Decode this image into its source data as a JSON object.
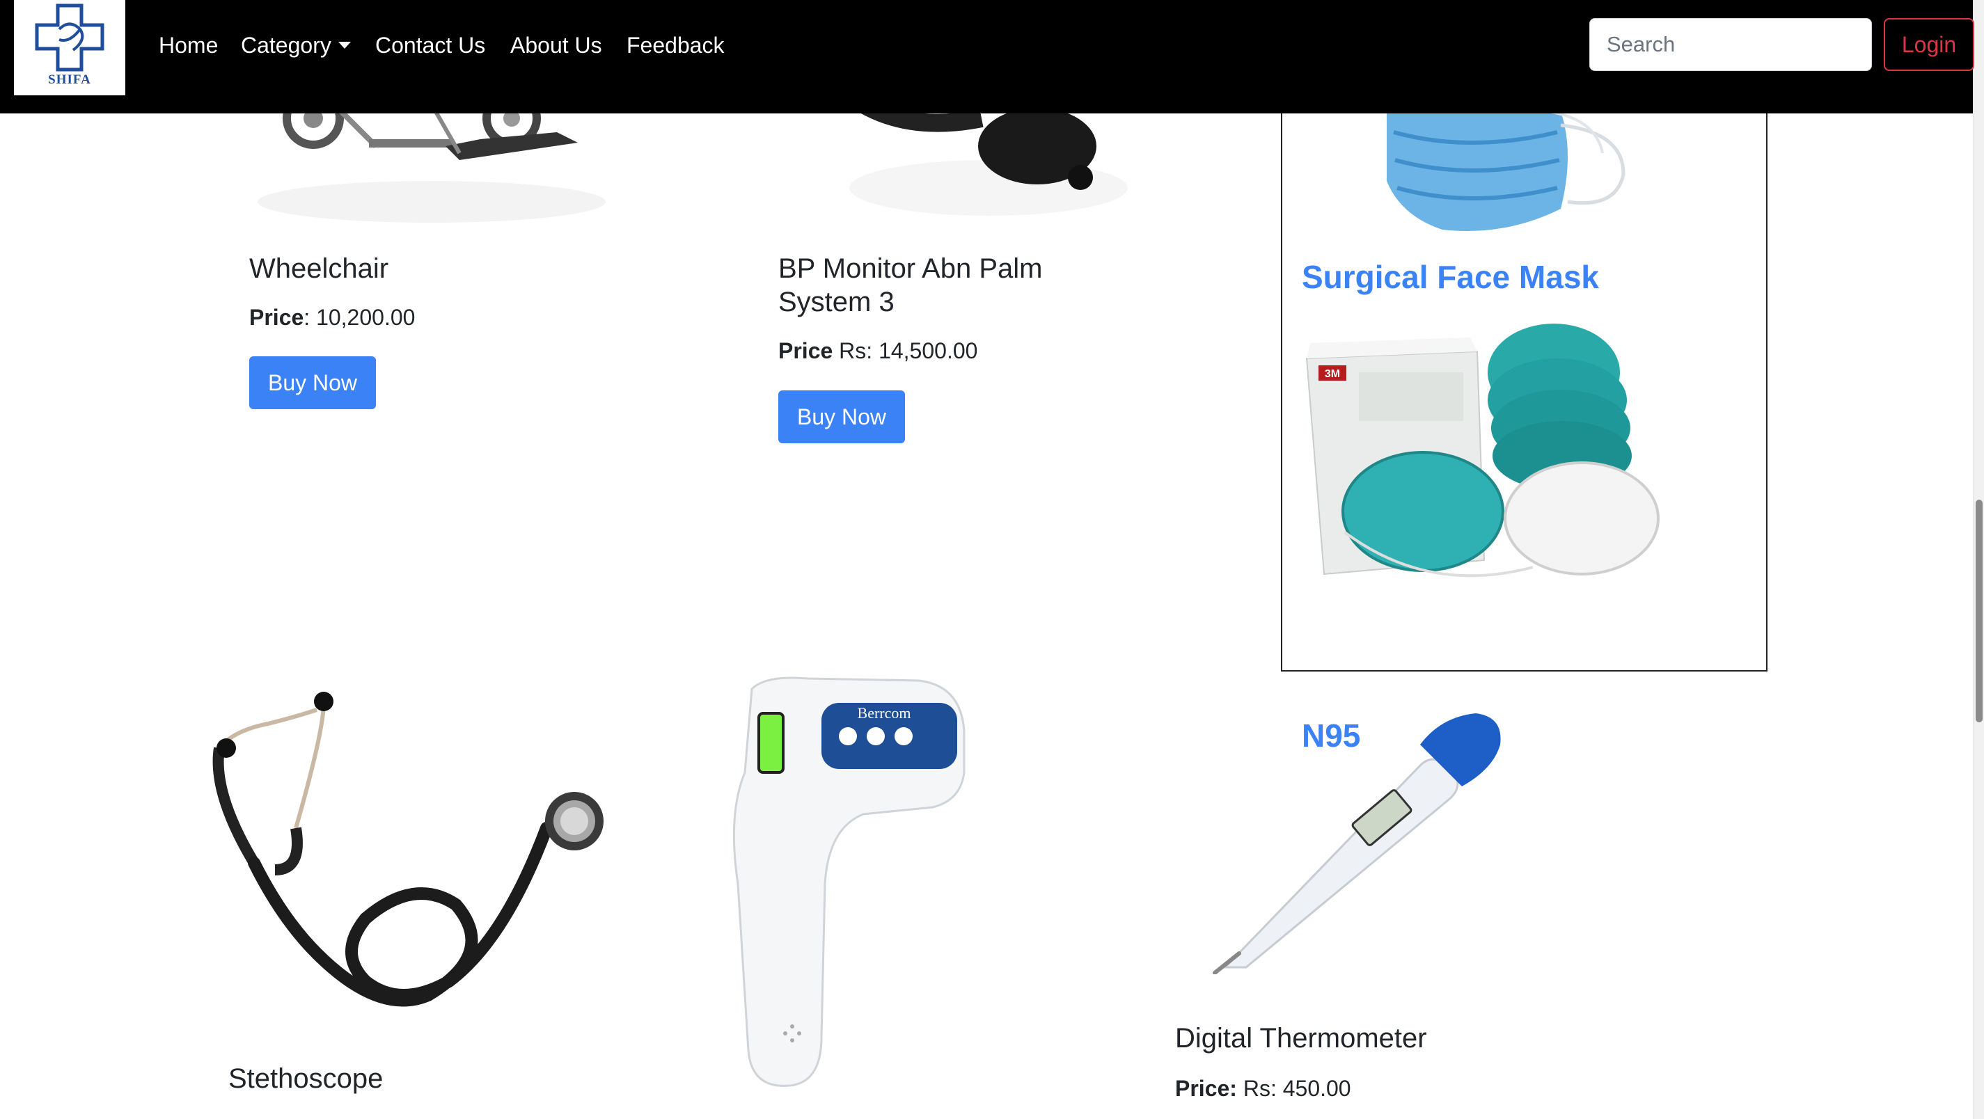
{
  "brand": {
    "name": "SHIFA"
  },
  "nav": {
    "home": "Home",
    "category": "Category",
    "contact": "Contact Us",
    "about": "About Us",
    "feedback": "Feedback"
  },
  "search": {
    "placeholder": "Search"
  },
  "login": {
    "label": "Login"
  },
  "products": [
    {
      "title": "Wheelchair",
      "price_label": "Price",
      "price_value": ": 10,200.00",
      "buy_label": "Buy Now"
    },
    {
      "title": "BP Monitor Abn Palm System 3",
      "price_label": "Price",
      "price_value": " Rs: 14,500.00",
      "buy_label": "Buy Now"
    },
    {
      "title": "Stethoscope"
    },
    {
      "title": "Digital Thermometer",
      "price_label": "Price:",
      "price_value": " Rs: 450.00"
    }
  ],
  "side_card": {
    "items": [
      {
        "title": "Surgical Face Mask"
      },
      {
        "title": "N95"
      }
    ]
  },
  "colors": {
    "nav_bg": "#000000",
    "accent": "#3b82f6",
    "login": "#dc3545"
  }
}
